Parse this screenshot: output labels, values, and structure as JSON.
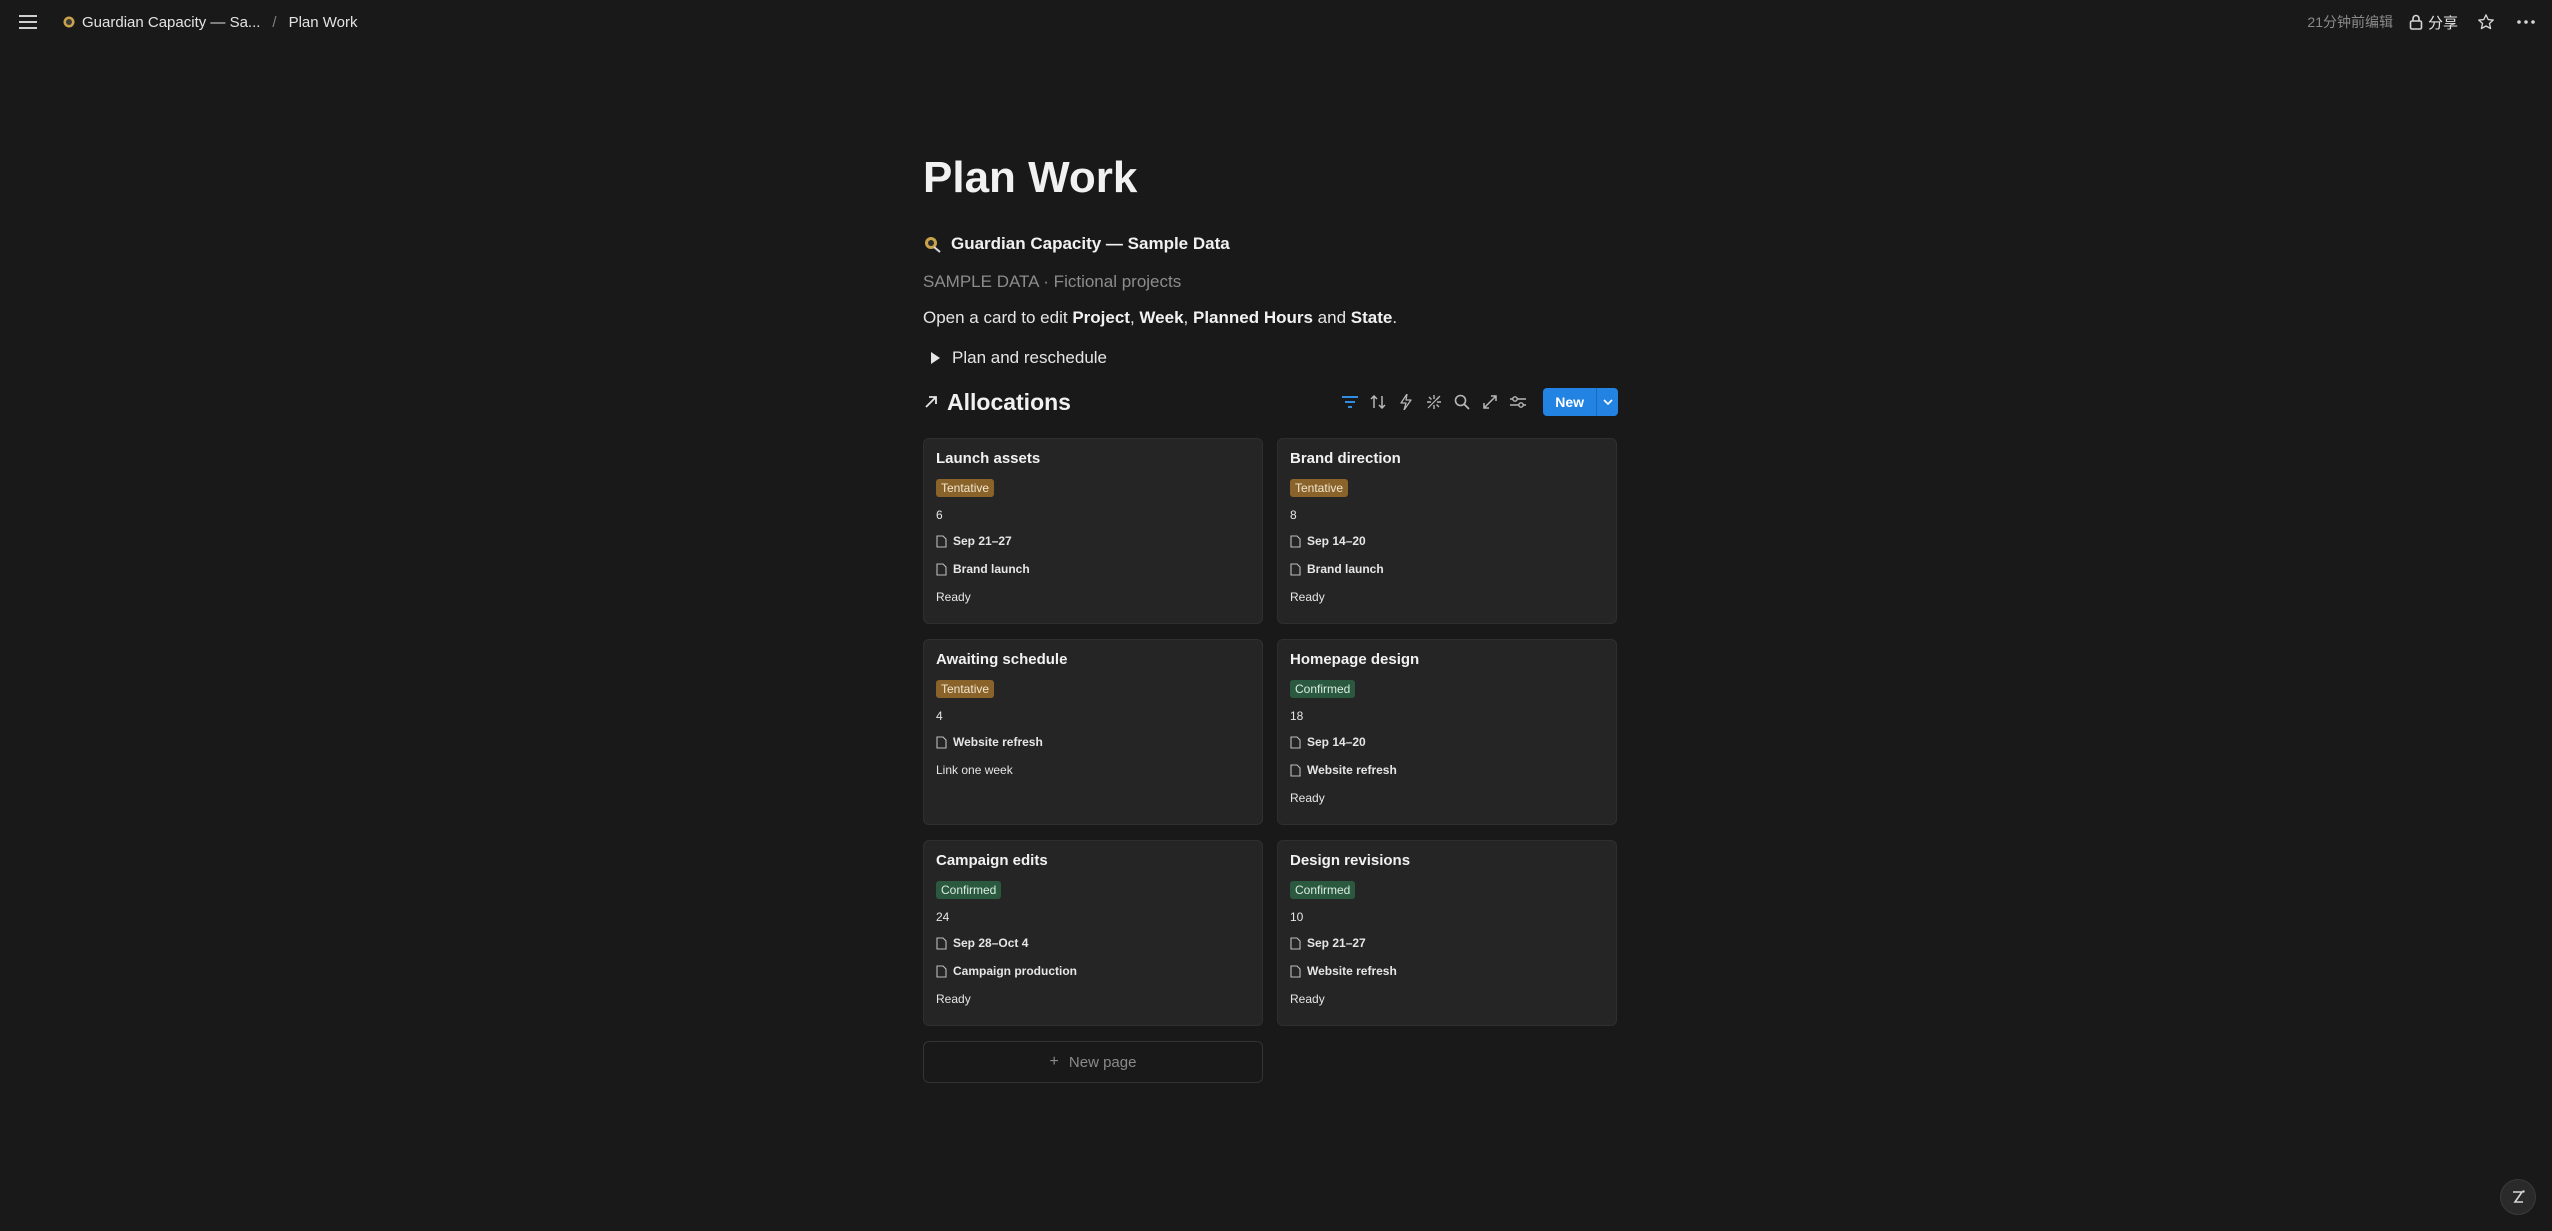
{
  "topbar": {
    "workspace_crumb": "Guardian Capacity — Sa...",
    "page_crumb": "Plan Work",
    "edited": "21分钟前编辑",
    "share_label": "分享"
  },
  "page": {
    "title": "Plan Work",
    "subhead": "Guardian Capacity — Sample Data",
    "sample_note": "SAMPLE DATA · Fictional projects",
    "instruction": {
      "prefix": "Open a card to edit ",
      "f1": "Project",
      "sep1": ", ",
      "f2": "Week",
      "sep2": ", ",
      "f3": "Planned Hours",
      "sep3": " and ",
      "f4": "State",
      "suffix": "."
    },
    "toggle_label": "Plan and reschedule"
  },
  "database": {
    "title": "Allocations",
    "new_label": "New",
    "new_page_label": "New page",
    "cards": [
      {
        "title": "Launch assets",
        "tag": "Tentative",
        "tag_type": "tentative",
        "hours": "6",
        "week": "Sep 21–27",
        "project": "Brand launch",
        "status": "Ready"
      },
      {
        "title": "Brand direction",
        "tag": "Tentative",
        "tag_type": "tentative",
        "hours": "8",
        "week": "Sep 14–20",
        "project": "Brand launch",
        "status": "Ready"
      },
      {
        "title": "Awaiting schedule",
        "tag": "Tentative",
        "tag_type": "tentative",
        "hours": "4",
        "week": "",
        "project": "Website refresh",
        "status": "Link one week"
      },
      {
        "title": "Homepage design",
        "tag": "Confirmed",
        "tag_type": "confirmed",
        "hours": "18",
        "week": "Sep 14–20",
        "project": "Website refresh",
        "status": "Ready"
      },
      {
        "title": "Campaign edits",
        "tag": "Confirmed",
        "tag_type": "confirmed",
        "hours": "24",
        "week": "Sep 28–Oct 4",
        "project": "Campaign production",
        "status": "Ready"
      },
      {
        "title": "Design revisions",
        "tag": "Confirmed",
        "tag_type": "confirmed",
        "hours": "10",
        "week": "Sep 21–27",
        "project": "Website refresh",
        "status": "Ready"
      }
    ]
  },
  "colors": {
    "background": "#191919",
    "card": "#252525",
    "accent": "#2383e2",
    "tentative": "#89632a",
    "confirmed": "#2b593f"
  }
}
